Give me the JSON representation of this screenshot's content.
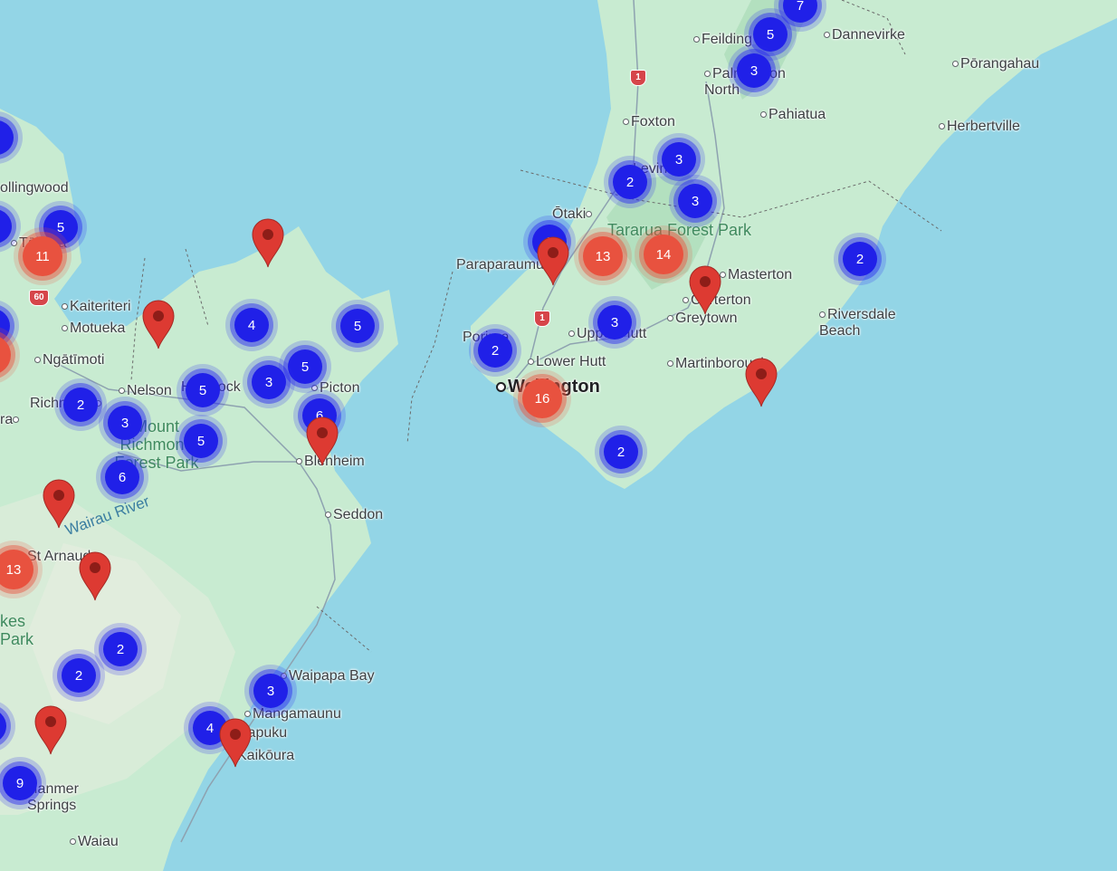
{
  "map": {
    "colors": {
      "water": "#93d5e6",
      "land": "#c8ebd1",
      "cluster_blue": "#2020e8",
      "cluster_red": "#e8523f",
      "pin": "#dd3a32"
    },
    "places": [
      {
        "name": "Feilding",
        "kind": "town"
      },
      {
        "name": "Dannevirke",
        "kind": "town"
      },
      {
        "name": "Pōrangahau",
        "kind": "town"
      },
      {
        "name": "Palmerston North",
        "kind": "town"
      },
      {
        "name": "Foxton",
        "kind": "town"
      },
      {
        "name": "Pahiatua",
        "kind": "town"
      },
      {
        "name": "Herbertville",
        "kind": "town"
      },
      {
        "name": "Levin",
        "kind": "town"
      },
      {
        "name": "Ōtaki",
        "kind": "town"
      },
      {
        "name": "Paraparaumu",
        "kind": "town"
      },
      {
        "name": "Masterton",
        "kind": "town"
      },
      {
        "name": "Carterton",
        "kind": "town"
      },
      {
        "name": "Greytown",
        "kind": "town"
      },
      {
        "name": "Riversdale Beach",
        "kind": "town"
      },
      {
        "name": "Porirua",
        "kind": "town"
      },
      {
        "name": "Upper Hutt",
        "kind": "town"
      },
      {
        "name": "Lower Hutt",
        "kind": "town"
      },
      {
        "name": "Martinborough",
        "kind": "town"
      },
      {
        "name": "Wellington",
        "kind": "city"
      },
      {
        "name": "ollingwood",
        "kind": "town"
      },
      {
        "name": "Tākaka",
        "kind": "town"
      },
      {
        "name": "Kaiteriteri",
        "kind": "town"
      },
      {
        "name": "Motueka",
        "kind": "town"
      },
      {
        "name": "Ngātīmoti",
        "kind": "town"
      },
      {
        "name": "Nelson",
        "kind": "town"
      },
      {
        "name": "Havelock",
        "kind": "town"
      },
      {
        "name": "Picton",
        "kind": "town"
      },
      {
        "name": "Richmond",
        "kind": "town"
      },
      {
        "name": "ra",
        "kind": "town"
      },
      {
        "name": "Blenheim",
        "kind": "town"
      },
      {
        "name": "Seddon",
        "kind": "town"
      },
      {
        "name": "St Arnaud",
        "kind": "town"
      },
      {
        "name": "Waipapa Bay",
        "kind": "town"
      },
      {
        "name": "Mangamaunu",
        "kind": "town"
      },
      {
        "name": "Hapuku",
        "kind": "town"
      },
      {
        "name": "Kaikōura",
        "kind": "town"
      },
      {
        "name": "Hanmer Springs",
        "kind": "town"
      },
      {
        "name": "Waiau",
        "kind": "town"
      }
    ],
    "parks": [
      "Tararua Forest Park",
      "Mount Richmond Forest Park",
      "kes Park"
    ],
    "river": "Wairau River",
    "highway_shields": [
      "1",
      "1",
      "60"
    ],
    "clusters": [
      {
        "count": "7",
        "color": "blue"
      },
      {
        "count": "5",
        "color": "blue"
      },
      {
        "count": "3",
        "color": "blue"
      },
      {
        "count": "3",
        "color": "blue"
      },
      {
        "count": "2",
        "color": "blue"
      },
      {
        "count": "3",
        "color": "blue"
      },
      {
        "count": "2",
        "color": "blue"
      },
      {
        "count": "13",
        "color": "red"
      },
      {
        "count": "14",
        "color": "red"
      },
      {
        "count": "2",
        "color": "blue"
      },
      {
        "count": "3",
        "color": "blue"
      },
      {
        "count": "2",
        "color": "blue"
      },
      {
        "count": "16",
        "color": "red"
      },
      {
        "count": "2",
        "color": "blue"
      },
      {
        "count": "5",
        "color": "blue"
      },
      {
        "count": "11",
        "color": "red"
      },
      {
        "count": "4",
        "color": "blue"
      },
      {
        "count": "5",
        "color": "blue"
      },
      {
        "count": "5",
        "color": "blue"
      },
      {
        "count": "3",
        "color": "blue"
      },
      {
        "count": "5",
        "color": "blue"
      },
      {
        "count": "6",
        "color": "blue"
      },
      {
        "count": "2",
        "color": "blue"
      },
      {
        "count": "3",
        "color": "blue"
      },
      {
        "count": "5",
        "color": "blue"
      },
      {
        "count": "6",
        "color": "blue"
      },
      {
        "count": "13",
        "color": "red"
      },
      {
        "count": "2",
        "color": "blue"
      },
      {
        "count": "2",
        "color": "blue"
      },
      {
        "count": "3",
        "color": "blue"
      },
      {
        "count": "4",
        "color": "blue"
      },
      {
        "count": "9",
        "color": "blue"
      }
    ]
  }
}
